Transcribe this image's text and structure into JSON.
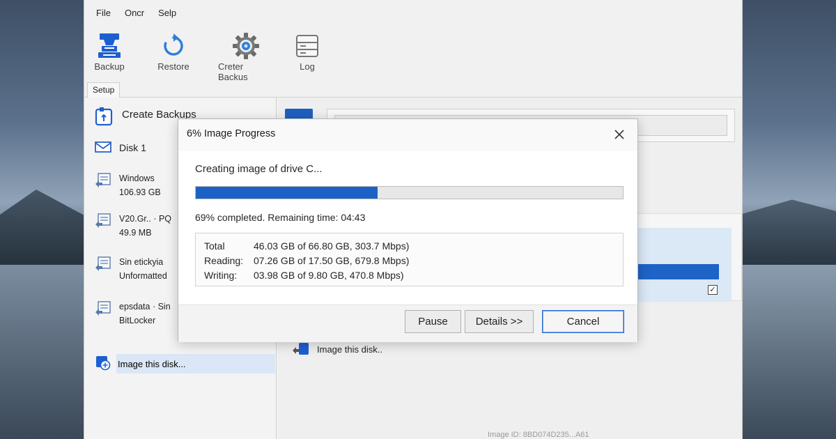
{
  "menu": [
    "File",
    "Oncr",
    "Selp"
  ],
  "toolbar": [
    {
      "label": "Backup",
      "icon": "backup-icon"
    },
    {
      "label": "Restore",
      "icon": "restore-icon"
    },
    {
      "label": "Creter Backus",
      "icon": "gear-icon"
    },
    {
      "label": "Log",
      "icon": "log-icon"
    }
  ],
  "tab": {
    "label": "Setup"
  },
  "sidebar": {
    "create_backups": "Create Backups",
    "disk_label": "Disk 1",
    "partitions": [
      {
        "line1": "Windows",
        "line2": "106.93 GB"
      },
      {
        "line1": "V20.Gr.. · PQ",
        "line2": "49.9 MB"
      },
      {
        "line1": "Sin etickyia",
        "line2": "Unformatted"
      },
      {
        "line1": "epsdata · Sin",
        "line2": "BitLocker"
      }
    ],
    "image_disk": "Image this disk..."
  },
  "main": {
    "image_disk": "Image this disk.."
  },
  "statusbar": {
    "text": "Image ID: 8BD074D235...A61"
  },
  "dialog": {
    "title": "6% Image Progress",
    "message": "Creating image of drive C...",
    "progress_fraction": 0.426,
    "status": "69% completed. Remaining time: 04:43",
    "stats": [
      {
        "label": "Total",
        "value": "46.03 GB of 66.80 GB, 303.7 Mbps)"
      },
      {
        "label": "Reading:",
        "value": "07.26 GB of 17.50 GB, 679.8 Mbps)"
      },
      {
        "label": "Writing:",
        "value": "03.98 GB of 9.80 GB, 470.8 Mbps)"
      }
    ],
    "buttons": {
      "pause": "Pause",
      "details": "Details >>",
      "cancel": "Cancel"
    }
  },
  "colors": {
    "accent": "#1c62c6",
    "selection": "#dbe7f6"
  }
}
